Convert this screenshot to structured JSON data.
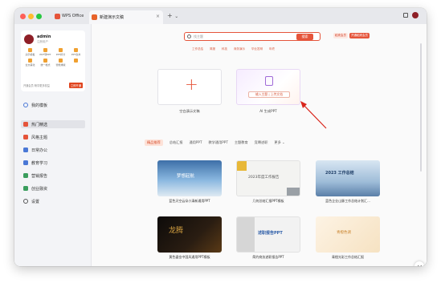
{
  "window": {
    "app_tab_label": "WPS Office",
    "doc_tab_label": "新建演示文稿",
    "close_glyph": "×",
    "new_tab_glyph": "+",
    "tab_menu_glyph": "⌄"
  },
  "user": {
    "name": "admin",
    "plan": "注册用户",
    "features": [
      {
        "label": "演示模板",
        "icon": "template-icon"
      },
      {
        "label": "PDF转PPT",
        "icon": "pdf-convert-icon"
      },
      {
        "label": "PPT拆分",
        "icon": "split-icon"
      },
      {
        "label": "PPT合并",
        "icon": "merge-icon"
      },
      {
        "label": "全文美化",
        "icon": "beautify-icon"
      },
      {
        "label": "统一格式",
        "icon": "format-icon"
      },
      {
        "label": "智能排版",
        "icon": "layout-icon"
      },
      {
        "label": "",
        "icon": "more-icon"
      }
    ],
    "promo_text": "开通会员 畅享更多权益",
    "promo_button": "立即开通"
  },
  "sidebar": {
    "my_templates": "我的模板",
    "items": [
      {
        "label": "热门精选",
        "icon": "hot-icon",
        "color": "#e5543a",
        "active": true
      },
      {
        "label": "风格主题",
        "icon": "palette-icon",
        "color": "#e5543a",
        "active": false
      },
      {
        "label": "日常办公",
        "icon": "office-icon",
        "color": "#4a78d6",
        "active": false
      },
      {
        "label": "教育学习",
        "icon": "education-icon",
        "color": "#4a78d6",
        "active": false
      },
      {
        "label": "营销报告",
        "icon": "marketing-icon",
        "color": "#3a9d5d",
        "active": false
      },
      {
        "label": "创业融资",
        "icon": "finance-icon",
        "color": "#3a9d5d",
        "active": false
      },
      {
        "label": "设置",
        "icon": "gear-icon",
        "color": "#555555",
        "active": false
      }
    ]
  },
  "search": {
    "placeholder": "找主题",
    "button": "搜索",
    "vip_label": "稻壳会员",
    "vip_action": "开通稻壳会员"
  },
  "hotwords": [
    "工作总结",
    "简报",
    "科技",
    "商务演示",
    "毕业答辩",
    "年终"
  ],
  "new_items": [
    {
      "label": "空白演示文稿",
      "glyph": "+"
    },
    {
      "label": "AI 生成PPT",
      "input_hint": "输入主题 | 上传文档"
    }
  ],
  "categories": [
    "精品推荐",
    "总结汇报",
    "通用PPT",
    "教学通用PPT",
    "主题教育",
    "竞聘述职",
    "更多"
  ],
  "categories_more_glyph": "⌄",
  "templates": [
    {
      "label": "蓝色天空云朵小清新通用PPT",
      "title": "梦想起航",
      "bg": "#5a92c8"
    },
    {
      "label": "几何总结汇报PPT模板",
      "title": "2023年度工作报告",
      "bg": "#f3f3f1"
    },
    {
      "label": "蓝色企业山脉工作总结计划汇...",
      "title": "2023 工作总结",
      "bg": "#bcd4e8"
    },
    {
      "label": "黄色鎏金中国风通用PPT模板",
      "title": "龙腾",
      "bg": "#1c1410"
    },
    {
      "label": "简约商务述职报告PPT",
      "title": "述职报告PPT",
      "bg": "#f0f0f0"
    },
    {
      "label": "青橙光彩工作总结汇报",
      "title": "青橙色调",
      "bg": "#f8ecd8"
    }
  ],
  "colors": {
    "accent": "#e5543a",
    "arrow": "#d9261c"
  }
}
